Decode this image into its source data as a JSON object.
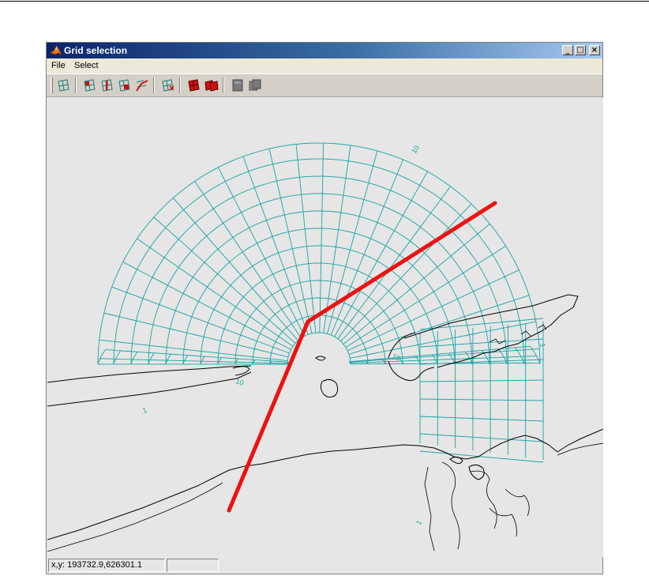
{
  "window": {
    "title": "Grid selection",
    "controls": {
      "minimize": "_",
      "maximize": "□",
      "close": "×"
    }
  },
  "menu": {
    "items": [
      {
        "label": "File"
      },
      {
        "label": "Select"
      }
    ]
  },
  "toolbar": {
    "buttons": [
      {
        "icon": "grid-point-icon"
      },
      {
        "icon": "grid-select-icon"
      },
      {
        "icon": "grid-select-line-icon"
      },
      {
        "icon": "grid-select-area-icon"
      },
      {
        "icon": "polyline-select-icon"
      },
      {
        "icon": "grid-deselect-icon"
      },
      {
        "icon": "grid-fill-icon"
      },
      {
        "icon": "grid-fill-all-icon"
      },
      {
        "icon": "layer-icon"
      },
      {
        "icon": "layers-icon"
      }
    ]
  },
  "plot": {
    "grid_labels": [
      "10",
      "10",
      "10",
      "1",
      "1",
      "1"
    ],
    "colors": {
      "grid": "#1aa3a3",
      "selection_line": "#ee1111",
      "coastline": "#000000",
      "background": "#e6e6e6"
    }
  },
  "status": {
    "coordinates": "x,y: 193732.9,626301.1",
    "secondary": ""
  }
}
